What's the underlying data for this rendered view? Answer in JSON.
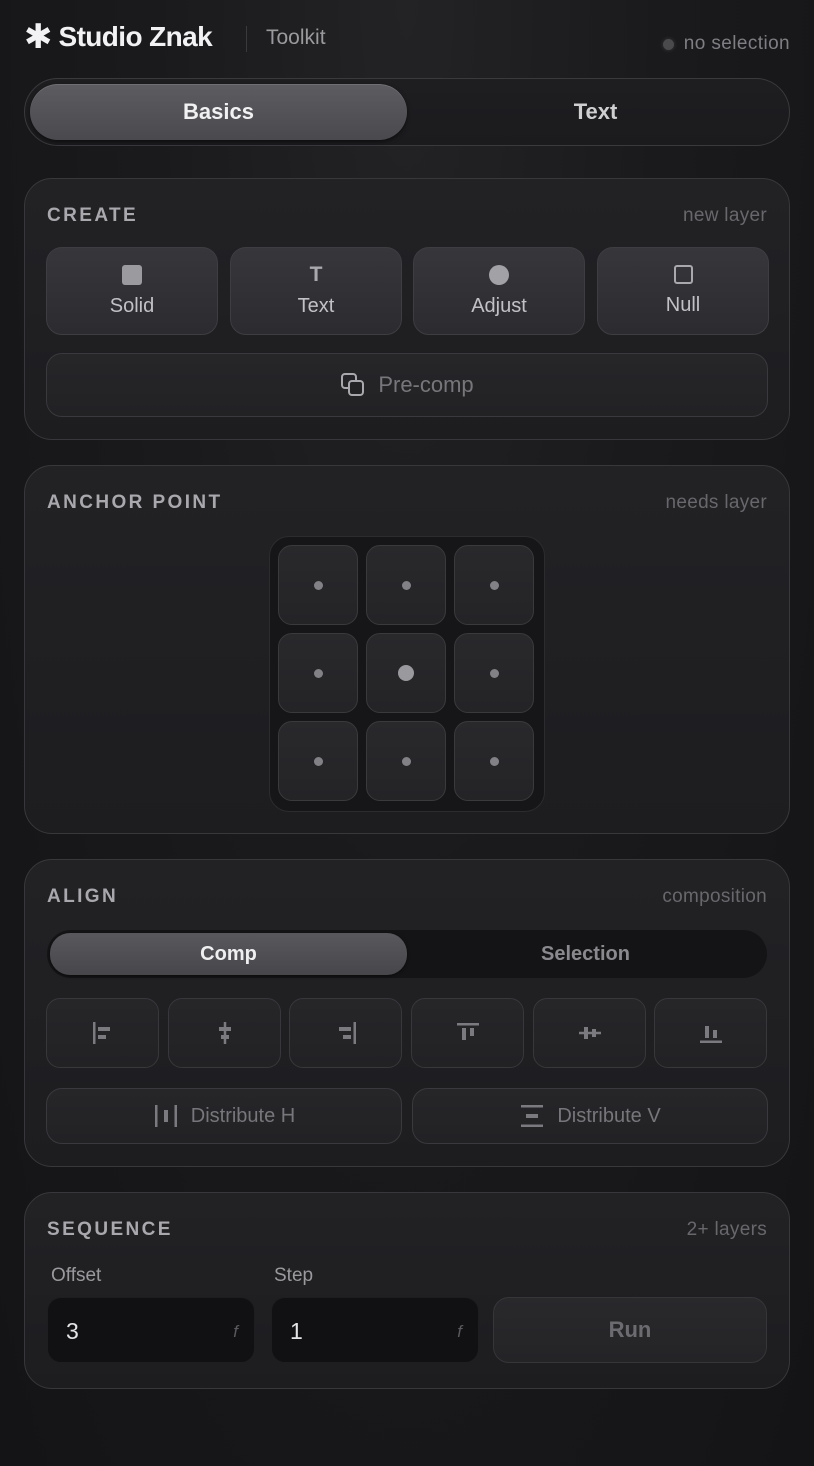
{
  "header": {
    "logo_mark": "✱",
    "brand": "Studio Znak",
    "subtitle": "Toolkit",
    "status": "no selection"
  },
  "tabs": [
    {
      "label": "Basics",
      "active": true
    },
    {
      "label": "Text",
      "active": false
    }
  ],
  "create": {
    "title": "CREATE",
    "note": "new layer",
    "buttons": [
      {
        "label": "Solid",
        "icon": "square-filled-icon"
      },
      {
        "label": "Text",
        "icon": "text-t-icon",
        "glyph": "T"
      },
      {
        "label": "Adjust",
        "icon": "circle-filled-icon"
      },
      {
        "label": "Null",
        "icon": "square-outline-icon"
      }
    ],
    "precomp_label": "Pre-comp"
  },
  "anchor": {
    "title": "ANCHOR POINT",
    "note": "needs layer",
    "selected": "center"
  },
  "align": {
    "title": "ALIGN",
    "note": "composition",
    "modes": [
      {
        "label": "Comp",
        "active": true
      },
      {
        "label": "Selection",
        "active": false
      }
    ],
    "buttons": [
      "align-left-icon",
      "align-center-h-icon",
      "align-right-icon",
      "align-top-icon",
      "align-middle-v-icon",
      "align-bottom-icon"
    ],
    "distribute_h": "Distribute H",
    "distribute_v": "Distribute V"
  },
  "sequence": {
    "title": "SEQUENCE",
    "note": "2+ layers",
    "offset_label": "Offset",
    "offset_value": "3",
    "step_label": "Step",
    "step_value": "1",
    "unit": "f",
    "run_label": "Run"
  },
  "colors": {
    "background": "#1a1a1c",
    "card": "#202023",
    "active_tab": "#545458"
  }
}
